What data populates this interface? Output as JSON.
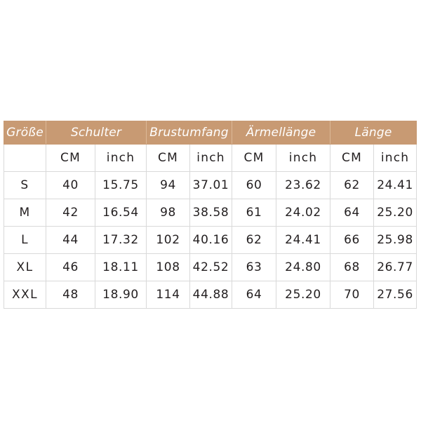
{
  "table": {
    "size_column_label": "Größe",
    "measurement_groups": [
      {
        "label": "Schulter"
      },
      {
        "label": "Brustumfang"
      },
      {
        "label": "Ärmellänge"
      },
      {
        "label": "Länge"
      }
    ],
    "unit_headers": {
      "size_blank": "",
      "cm": "CM",
      "inch": "inch"
    },
    "rows": [
      {
        "size": "S",
        "schulter_cm": "40",
        "schulter_inch": "15.75",
        "brust_cm": "94",
        "brust_inch": "37.01",
        "aermel_cm": "60",
        "aermel_inch": "23.62",
        "laenge_cm": "62",
        "laenge_inch": "24.41"
      },
      {
        "size": "M",
        "schulter_cm": "42",
        "schulter_inch": "16.54",
        "brust_cm": "98",
        "brust_inch": "38.58",
        "aermel_cm": "61",
        "aermel_inch": "24.02",
        "laenge_cm": "64",
        "laenge_inch": "25.20"
      },
      {
        "size": "L",
        "schulter_cm": "44",
        "schulter_inch": "17.32",
        "brust_cm": "102",
        "brust_inch": "40.16",
        "aermel_cm": "62",
        "aermel_inch": "24.41",
        "laenge_cm": "66",
        "laenge_inch": "25.98"
      },
      {
        "size": "XL",
        "schulter_cm": "46",
        "schulter_inch": "18.11",
        "brust_cm": "108",
        "brust_inch": "42.52",
        "aermel_cm": "63",
        "aermel_inch": "24.80",
        "laenge_cm": "68",
        "laenge_inch": "26.77"
      },
      {
        "size": "XXL",
        "schulter_cm": "48",
        "schulter_inch": "18.90",
        "brust_cm": "114",
        "brust_inch": "44.88",
        "aermel_cm": "64",
        "aermel_inch": "25.20",
        "laenge_cm": "70",
        "laenge_inch": "27.56"
      }
    ]
  },
  "colors": {
    "header_background": "#c89a73",
    "header_text": "#ffffff",
    "body_text": "#231f20",
    "grid_line": "#d9d9d9",
    "page_background": "#ffffff"
  }
}
